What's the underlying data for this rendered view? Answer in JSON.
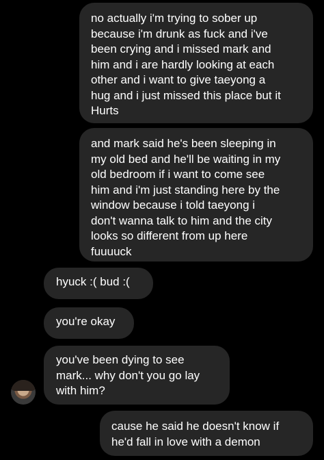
{
  "messages": [
    {
      "direction": "sent",
      "text": "no actually i'm trying to sober up\nbecause i'm drunk as fuck and i've\nbeen crying and i missed mark and\nhim and i are hardly looking at each\nother and i want to give taeyong a\nhug and i just missed this place but it\nHurts"
    },
    {
      "direction": "sent",
      "text": "and mark said he's been sleeping in\nmy old bed and he'll be waiting in my\nold bedroom if i want to come see\nhim and i'm just standing here by the\nwindow because i told taeyong i\ndon't wanna talk to him and the city\nlooks so different from up here\nfuuuuck"
    },
    {
      "direction": "received",
      "text": "hyuck :( bud :("
    },
    {
      "direction": "received",
      "text": "you're okay"
    },
    {
      "direction": "received",
      "text": "you've been dying to see\nmark... why don't you go lay\nwith him?"
    },
    {
      "direction": "sent",
      "text": "cause he said he doesn't know if\nhe'd fall in love with a demon"
    }
  ],
  "colors": {
    "background": "#000000",
    "bubble": "#262626",
    "text": "#ffffff"
  },
  "avatar": {
    "icon": "contact-avatar-photo"
  }
}
